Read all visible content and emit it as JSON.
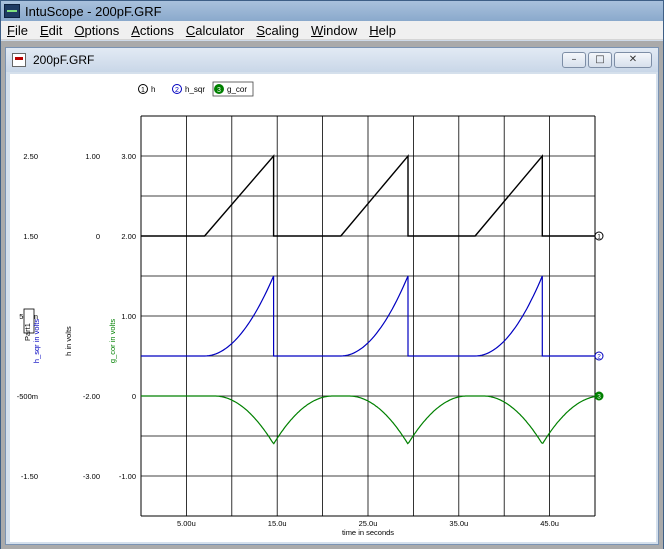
{
  "app": {
    "title": "IntuScope - 200pF.GRF"
  },
  "menu": [
    {
      "u": "F",
      "rest": "ile"
    },
    {
      "u": "E",
      "rest": "dit"
    },
    {
      "u": "O",
      "rest": "ptions"
    },
    {
      "u": "A",
      "rest": "ctions"
    },
    {
      "u": "C",
      "rest": "alculator"
    },
    {
      "u": "S",
      "rest": "caling"
    },
    {
      "u": "W",
      "rest": "indow"
    },
    {
      "u": "H",
      "rest": "elp"
    }
  ],
  "child_window": {
    "title": "200pF.GRF"
  },
  "legend": [
    {
      "num": "1",
      "name": "h",
      "color": "#000000"
    },
    {
      "num": "2",
      "name": "h_sqr",
      "color": "#0000c0"
    },
    {
      "num": "3",
      "name": "g_cor",
      "color": "#008000"
    }
  ],
  "axes": {
    "xlabel": "time in seconds",
    "axis_tags": [
      {
        "text": "Part1",
        "color": "#000000"
      },
      {
        "text": "h_sqr in volts",
        "color": "#0000c0"
      },
      {
        "text": "h in volts",
        "color": "#000000"
      },
      {
        "text": "g_cor in volts",
        "color": "#008000"
      }
    ],
    "x_ticks": [
      "5.00u",
      "15.0u",
      "25.0u",
      "35.0u",
      "45.0u"
    ],
    "tick_columns": [
      {
        "color": "#000000",
        "labels": [
          "2.50",
          "1.50",
          "500m",
          "-500m",
          "-1.50"
        ]
      },
      {
        "color": "#000000",
        "labels": [
          "1.00",
          "0",
          "",
          "-2.00",
          "-3.00"
        ]
      },
      {
        "color": "#000000",
        "labels": [
          "3.00",
          "2.00",
          "1.00",
          "0",
          "-1.00"
        ]
      }
    ]
  },
  "chart_data": {
    "type": "line",
    "xlabel": "time in seconds",
    "xlim": [
      0,
      50
    ],
    "x_unit": "microseconds",
    "series": [
      {
        "name": "h",
        "color": "#000000",
        "x": [
          0,
          7,
          14.6,
          14.6,
          22,
          29.4,
          29.4,
          36.8,
          44.2,
          44.2,
          50
        ],
        "y": [
          2.0,
          2.0,
          3.0,
          2.0,
          2.0,
          3.0,
          2.0,
          2.0,
          3.0,
          2.0,
          2.0
        ]
      },
      {
        "name": "h_sqr",
        "color": "#0000c0",
        "shape": "square-law",
        "segments": [
          [
            7,
            14.6
          ],
          [
            22,
            29.4
          ],
          [
            36.8,
            44.2
          ]
        ],
        "low": 0.5,
        "high": 1.5,
        "xlim": [
          0,
          50
        ]
      },
      {
        "name": "g_cor",
        "color": "#008000",
        "shape": "cusps",
        "minima": [
          14.6,
          29.4,
          44.2
        ],
        "baseline": 0,
        "min_value": -0.6,
        "xlim": [
          0,
          50
        ]
      }
    ]
  }
}
